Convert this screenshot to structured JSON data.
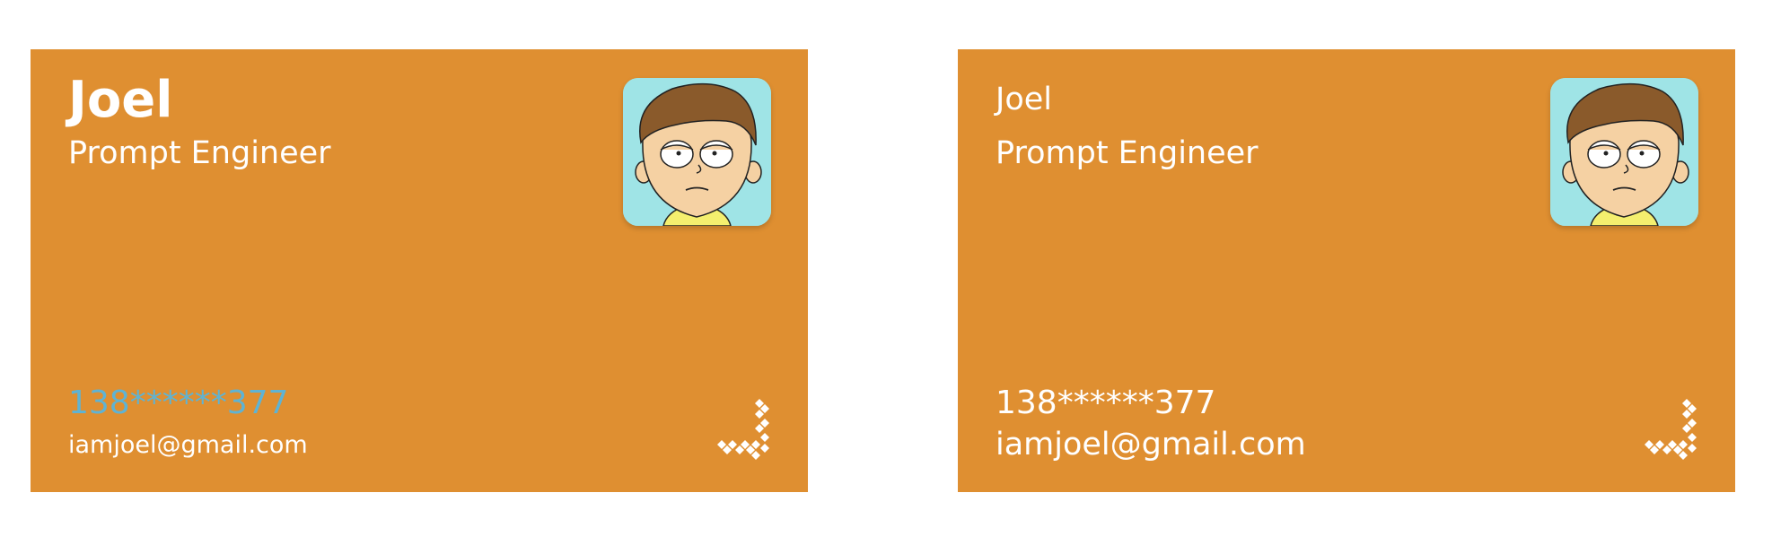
{
  "cards": [
    {
      "name": "Joel",
      "title": "Prompt Engineer",
      "phone": "138******377",
      "email": "iamjoel@gmail.com",
      "avatar_icon": "cartoon-face-avatar",
      "logo_icon": "diamond-dots-logo-icon"
    },
    {
      "name": "Joel",
      "title": "Prompt Engineer",
      "phone": "138******377",
      "email": "iamjoel@gmail.com",
      "avatar_icon": "cartoon-face-avatar",
      "logo_icon": "diamond-dots-logo-icon"
    }
  ],
  "colors": {
    "card_background": "#df8f31",
    "text": "#ffffff",
    "phone_highlight": "#5fb3d3",
    "avatar_background": "#9fe4e6"
  }
}
